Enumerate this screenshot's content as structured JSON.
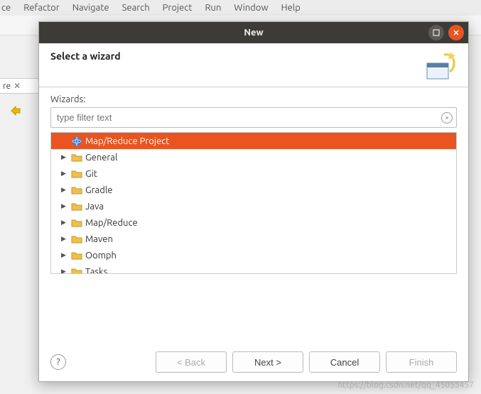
{
  "ide_menu": [
    "ce",
    "Refactor",
    "Navigate",
    "Search",
    "Project",
    "Run",
    "Window",
    "Help"
  ],
  "side_tab": {
    "label": "re",
    "close_glyph": "✕"
  },
  "dialog": {
    "title": "New",
    "banner_title": "Select a wizard",
    "wizards_label": "Wizards:",
    "filter_placeholder": "type filter text",
    "clear_glyph": "×",
    "tree": [
      {
        "label": "Map/Reduce Project",
        "selected": true,
        "leaf": true
      },
      {
        "label": "General",
        "selected": false,
        "leaf": false
      },
      {
        "label": "Git",
        "selected": false,
        "leaf": false
      },
      {
        "label": "Gradle",
        "selected": false,
        "leaf": false
      },
      {
        "label": "Java",
        "selected": false,
        "leaf": false
      },
      {
        "label": "Map/Reduce",
        "selected": false,
        "leaf": false
      },
      {
        "label": "Maven",
        "selected": false,
        "leaf": false
      },
      {
        "label": "Oomph",
        "selected": false,
        "leaf": false
      },
      {
        "label": "Tasks",
        "selected": false,
        "leaf": false
      }
    ],
    "buttons": {
      "help_glyph": "?",
      "back": "< Back",
      "next": "Next >",
      "cancel": "Cancel",
      "finish": "Finish"
    }
  },
  "watermark": "https://blog.csdn.net/qq_45055457"
}
